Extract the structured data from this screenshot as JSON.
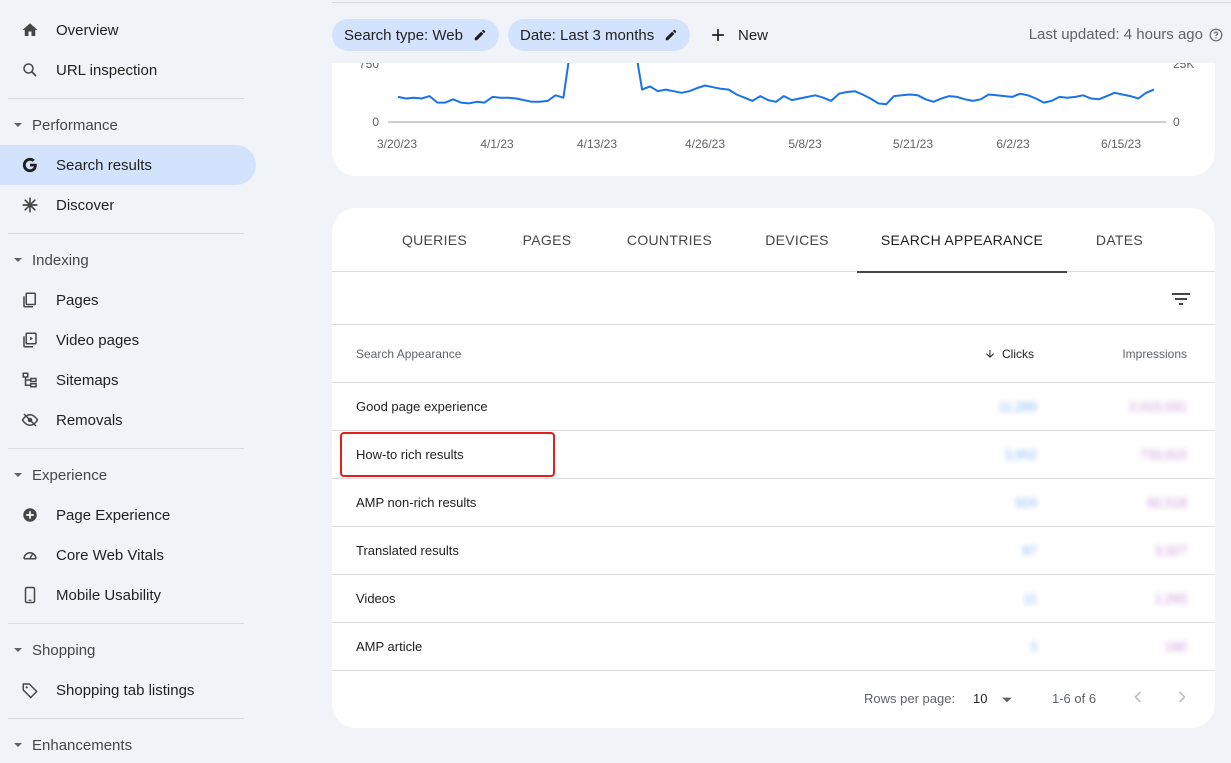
{
  "sidebar": {
    "top_items": [
      {
        "label": "Overview",
        "icon": "home-icon"
      },
      {
        "label": "URL inspection",
        "icon": "search-icon"
      }
    ],
    "sections": [
      {
        "title": "Performance",
        "items": [
          {
            "label": "Search results",
            "icon": "google-g-icon",
            "active": true
          },
          {
            "label": "Discover",
            "icon": "asterisk-icon"
          }
        ]
      },
      {
        "title": "Indexing",
        "items": [
          {
            "label": "Pages",
            "icon": "pages-icon"
          },
          {
            "label": "Video pages",
            "icon": "video-pages-icon"
          },
          {
            "label": "Sitemaps",
            "icon": "sitemap-icon"
          },
          {
            "label": "Removals",
            "icon": "eye-off-icon"
          }
        ]
      },
      {
        "title": "Experience",
        "items": [
          {
            "label": "Page Experience",
            "icon": "page-experience-icon"
          },
          {
            "label": "Core Web Vitals",
            "icon": "gauge-icon"
          },
          {
            "label": "Mobile Usability",
            "icon": "phone-icon"
          }
        ]
      },
      {
        "title": "Shopping",
        "items": [
          {
            "label": "Shopping tab listings",
            "icon": "tag-icon"
          }
        ]
      },
      {
        "title": "Enhancements",
        "items": []
      }
    ]
  },
  "toolbar": {
    "chip_search_type": "Search type: Web",
    "chip_date": "Date: Last 3 months",
    "new_label": "New",
    "last_updated": "Last updated: 4 hours ago"
  },
  "chart_data": {
    "type": "line",
    "x_ticks": [
      "3/20/23",
      "4/1/23",
      "4/13/23",
      "4/26/23",
      "5/8/23",
      "5/21/23",
      "6/2/23",
      "6/15/23"
    ],
    "y_left_ticks": [
      "750",
      "0"
    ],
    "y_right_ticks": [
      "25K",
      "0"
    ],
    "series": [
      {
        "color": "#1a73e8",
        "values": [
          31,
          29,
          30,
          29,
          32,
          24,
          24,
          28,
          24,
          23,
          25,
          24,
          31,
          30,
          30,
          29,
          27,
          25,
          25,
          26,
          33,
          30,
          30,
          31,
          30,
          29,
          28,
          34,
          30,
          29,
          36,
          40,
          44,
          38,
          40,
          38,
          36,
          38,
          42,
          45,
          43,
          41,
          40,
          34,
          30,
          26,
          32,
          27,
          25,
          32,
          27,
          29,
          31,
          33,
          30,
          26,
          35,
          37,
          38,
          34,
          29,
          23,
          22,
          32,
          33,
          34,
          33,
          28,
          25,
          29,
          32,
          31,
          28,
          26,
          28,
          34,
          33,
          32,
          31,
          35,
          33,
          29,
          24,
          26,
          31,
          30,
          31,
          33,
          29,
          28,
          32,
          36,
          34,
          32,
          29,
          36,
          40
        ]
      }
    ]
  },
  "tabs": [
    {
      "label": "QUERIES"
    },
    {
      "label": "PAGES"
    },
    {
      "label": "COUNTRIES"
    },
    {
      "label": "DEVICES"
    },
    {
      "label": "SEARCH APPEARANCE",
      "active": true
    },
    {
      "label": "DATES"
    }
  ],
  "table": {
    "headers": {
      "dimension": "Search Appearance",
      "clicks": "Clicks",
      "impressions": "Impressions"
    },
    "rows": [
      {
        "name": "Good page experience",
        "clicks": "11,289",
        "impressions": "2,015,031"
      },
      {
        "name": "How-to rich results",
        "clicks": "3,952",
        "impressions": "733,915"
      },
      {
        "name": "AMP non-rich results",
        "clicks": "924",
        "impressions": "92,518"
      },
      {
        "name": "Translated results",
        "clicks": "87",
        "impressions": "3,327"
      },
      {
        "name": "Videos",
        "clicks": "11",
        "impressions": "1,293"
      },
      {
        "name": "AMP article",
        "clicks": "3",
        "impressions": "190"
      }
    ]
  },
  "pager": {
    "rows_per_page_label": "Rows per page:",
    "rows_per_page_value": "10",
    "range": "1-6 of 6"
  },
  "colors": {
    "accent": "#1a73e8",
    "active_bg": "#d3e3fd",
    "highlight": "#e0201a"
  }
}
